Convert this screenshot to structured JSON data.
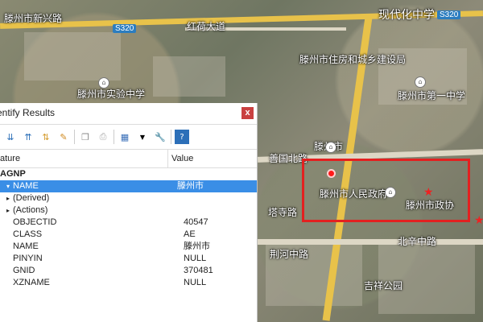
{
  "map": {
    "labels": {
      "yellow_badge": "S320",
      "yellow_badge_right": "S320",
      "place_top_left": "滕州市新兴路",
      "place_top_center": "红荷大道",
      "place_top_right": "现代化中学",
      "place_mid_left": "滕州市实验中学",
      "place_mid_center": "滕州市住房和城乡建设局",
      "place_right_upper": "滕州市第一中学",
      "place_center_left": "善国北路",
      "place_center": "滕州市",
      "place_box_left": "滕州市人民政府",
      "place_box_right": "滕州市政协",
      "place_road_west": "塔寺路",
      "place_bottom_center": "北辛中路",
      "place_bottom_left": "荆河中路",
      "place_bottom_right": "吉祥公园"
    }
  },
  "identify": {
    "title": "entify Results",
    "close": "x",
    "header": {
      "feature": "ature",
      "value": "Value"
    },
    "layer": "AGNP",
    "selected_key": "NAME",
    "selected_val": "滕州市",
    "derived": "(Derived)",
    "actions": "(Actions)",
    "attrs": [
      {
        "k": "OBJECTID",
        "v": "40547"
      },
      {
        "k": "CLASS",
        "v": "AE"
      },
      {
        "k": "NAME",
        "v": "滕州市"
      },
      {
        "k": "PINYIN",
        "v": "NULL"
      },
      {
        "k": "GNID",
        "v": "370481"
      },
      {
        "k": "XZNAME",
        "v": "NULL"
      }
    ]
  }
}
